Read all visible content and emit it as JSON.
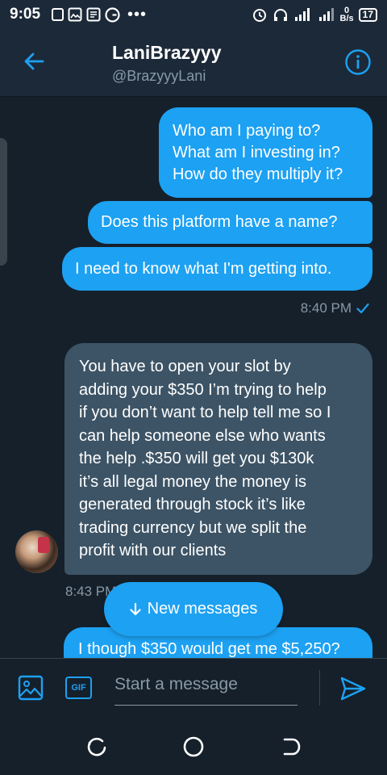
{
  "status_bar": {
    "time": "9:05",
    "network_speed": "0",
    "network_unit": "B/s",
    "battery": "17"
  },
  "header": {
    "name": "LaniBrazyyy",
    "handle": "@BrazyyyLani"
  },
  "messages": {
    "outgoing_1_lines": [
      "Who am I paying to?",
      "What am I investing in?",
      "How do they multiply it?"
    ],
    "outgoing_2": "Does this platform have a name?",
    "outgoing_3": "I need to know what I'm getting into.",
    "outgoing_time": "8:40 PM",
    "incoming_lines": [
      "You have to open your slot by",
      "adding your $350 I’m trying to help",
      "if you don’t want to help tell me so I",
      "can help someone else who wants",
      "the help .$350 will get you $130k",
      "it’s all legal money the money is",
      "generated through  stock it’s like",
      "trading currency but we split the",
      "profit with our clients"
    ],
    "incoming_time": "8:43 PM",
    "outgoing_4": "I though $350 would get me $5,250?"
  },
  "new_messages_label": "New messages",
  "composer": {
    "gif_label": "GIF",
    "placeholder": "Start a message"
  },
  "colors": {
    "accent": "#1da1f2",
    "background": "#15202b",
    "incoming_bubble": "#3d5466"
  }
}
